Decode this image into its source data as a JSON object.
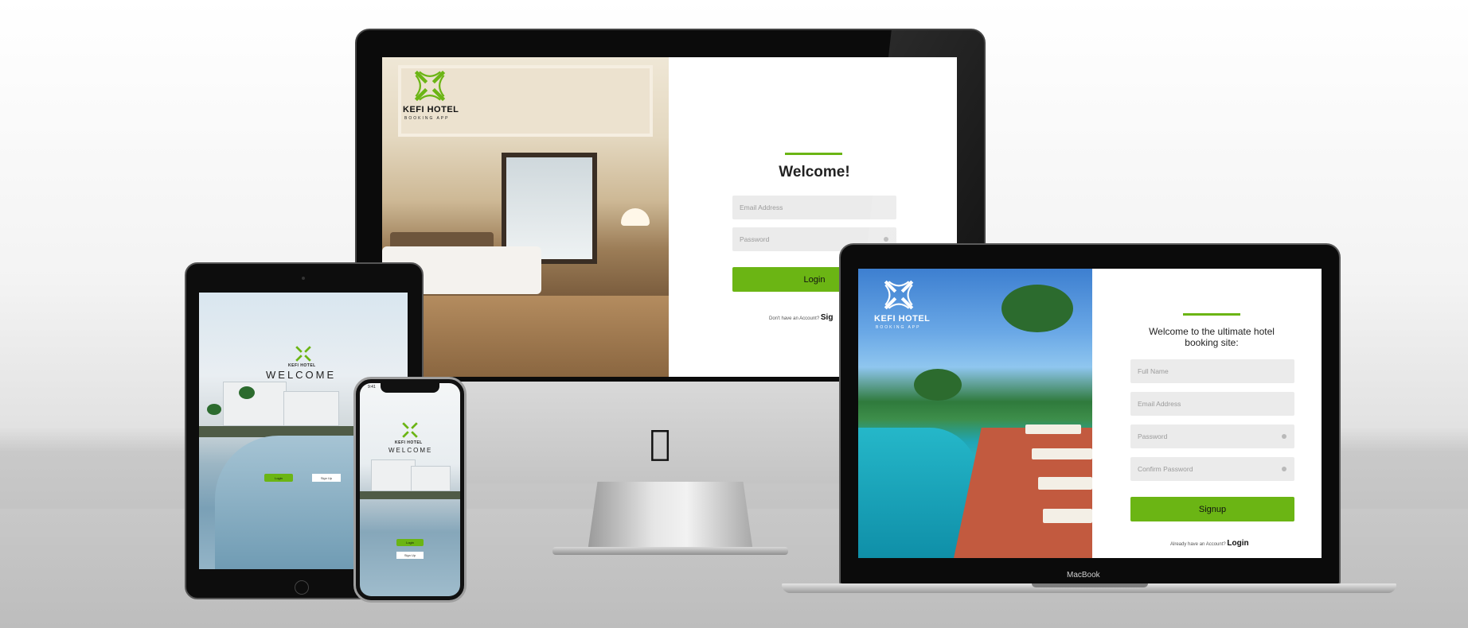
{
  "brand": {
    "name": "KEFI HOTEL",
    "subtitle": "BOOKING APP",
    "accent_color": "#6bb514"
  },
  "imac": {
    "heading": "Welcome!",
    "email_placeholder": "Email Address",
    "password_placeholder": "Password",
    "login_label": "Login",
    "footer_text": "Don't have an Account?",
    "footer_link": "Sig"
  },
  "ipad": {
    "welcome": "WELCOME",
    "login_label": "Login",
    "signup_label": "Sign Up"
  },
  "iphone": {
    "time": "9:41",
    "welcome": "WELCOME",
    "login_label": "Login",
    "signup_label": "Sign Up"
  },
  "macbook": {
    "heading": "Welcome to the ultimate hotel booking site:",
    "fullname_placeholder": "Full Name",
    "email_placeholder": "Email Address",
    "password_placeholder": "Password",
    "confirm_placeholder": "Confirm Password",
    "signup_label": "Signup",
    "footer_text": "Already have an Account?",
    "footer_link": "Login",
    "device_label": "MacBook"
  }
}
